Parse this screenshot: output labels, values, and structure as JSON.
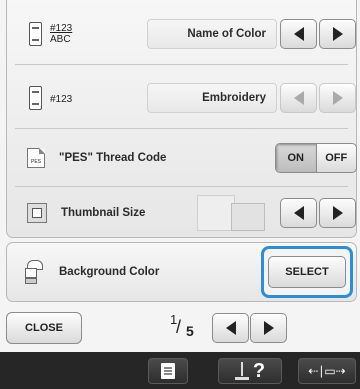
{
  "settings": {
    "thread_display": {
      "code_top": "#123",
      "code_bottom": "ABC",
      "value": "Name of Color"
    },
    "thread_number": {
      "code": "#123",
      "value": "Embroidery"
    },
    "pes_thread_code": {
      "label": "\"PES\" Thread Code",
      "icon_text": "PES",
      "on_label": "ON",
      "off_label": "OFF",
      "state": "ON"
    },
    "thumbnail_size": {
      "label": "Thumbnail Size"
    },
    "background_color": {
      "label": "Background Color",
      "button_label": "SELECT"
    }
  },
  "footer": {
    "close_label": "CLOSE",
    "page_current": "1",
    "page_total": "5"
  },
  "taskbar": {
    "help_label": "?"
  },
  "colors": {
    "highlight": "#2a8fd8",
    "taskbar": "#262626"
  }
}
